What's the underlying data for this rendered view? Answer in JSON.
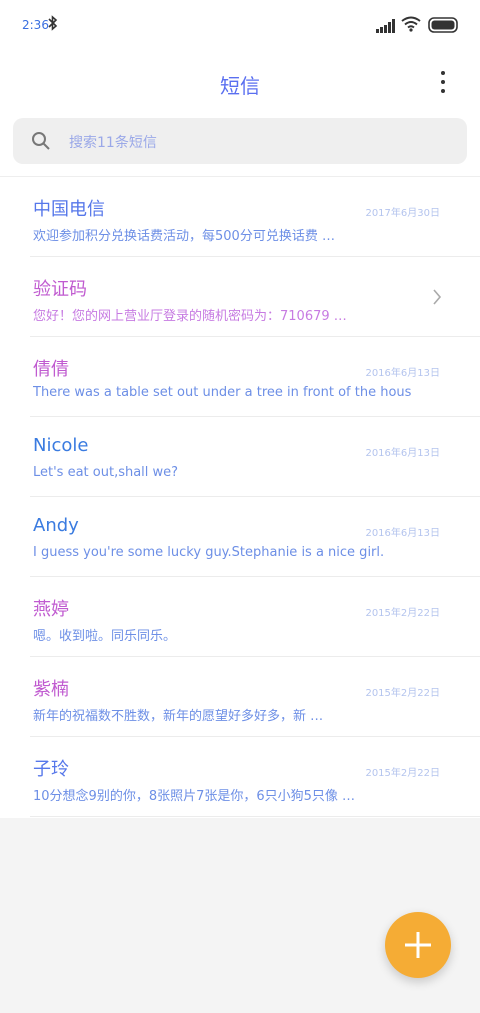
{
  "status": {
    "time": "2:36"
  },
  "header": {
    "title": "短信"
  },
  "search": {
    "placeholder": "搜索11条短信"
  },
  "messages": [
    {
      "name": "中国电信",
      "snippet": "欢迎参加积分兑换话费活动，每500分可兑换话费 …",
      "date": "2017年6月30日"
    },
    {
      "name": "验证码",
      "snippet": "您好！您的网上营业厅登录的随机密码为：710679 …"
    },
    {
      "name": "倩倩",
      "snippet": "There was a table set out under a tree in front of the hous",
      "date": "2016年6月13日"
    },
    {
      "name": "Nicole",
      "snippet": "Let's eat out,shall we?",
      "date": "2016年6月13日"
    },
    {
      "name": "Andy",
      "snippet": "I guess you're some lucky guy.Stephanie is a nice girl.",
      "date": "2016年6月13日"
    },
    {
      "name": "燕婷",
      "snippet": "嗯。收到啦。同乐同乐。",
      "date": "2015年2月22日"
    },
    {
      "name": "紫楠",
      "snippet": "新年的祝福数不胜数，新年的愿望好多好多，新 …",
      "date": "2015年2月22日"
    },
    {
      "name": "子玲",
      "snippet": "10分想念9别的你，8张照片7张是你，6只小狗5只像 …",
      "date": "2015年2月22日"
    }
  ],
  "colors": {
    "accent": "#5a6ff0",
    "fab": "#f5ac35"
  }
}
